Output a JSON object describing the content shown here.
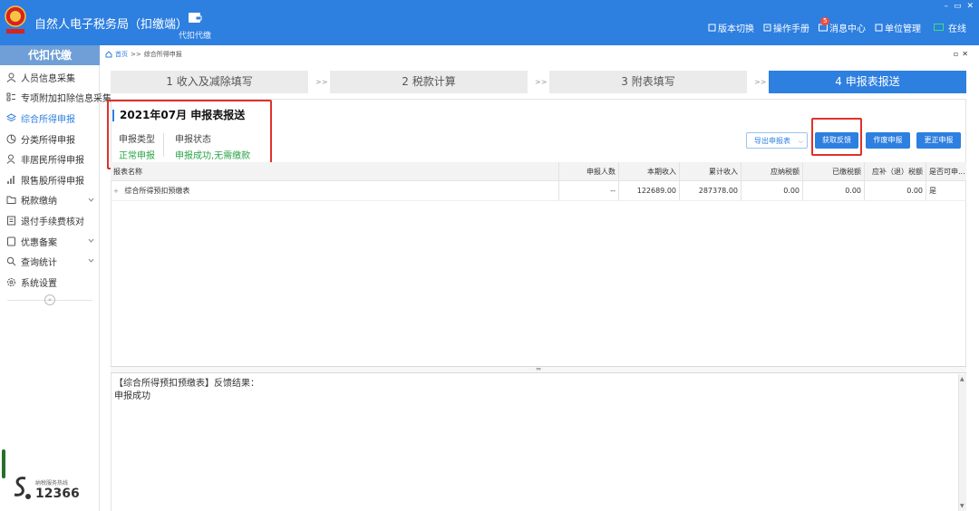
{
  "header": {
    "app_title": "自然人电子税务局（扣缴端）",
    "module_label": "代扣代缴",
    "links": {
      "version_switch": "版本切换",
      "manual": "操作手册",
      "message_center": "消息中心",
      "message_count": "5",
      "unit_management": "单位管理",
      "online_status": "在线"
    },
    "window_controls": [
      "–",
      "▭",
      "✕"
    ]
  },
  "sidebar": {
    "header": "代扣代缴",
    "items": [
      {
        "label": "人员信息采集",
        "icon": "person-icon"
      },
      {
        "label": "专项附加扣除信息采集",
        "icon": "list-icon"
      },
      {
        "label": "综合所得申报",
        "icon": "layers-icon",
        "active": true
      },
      {
        "label": "分类所得申报",
        "icon": "pie-icon"
      },
      {
        "label": "非居民所得申报",
        "icon": "user-icon"
      },
      {
        "label": "限售股所得申报",
        "icon": "bar-chart-icon"
      },
      {
        "label": "税款缴纳",
        "icon": "folder-icon",
        "expandable": true
      },
      {
        "label": "退付手续费核对",
        "icon": "document-icon"
      },
      {
        "label": "优惠备案",
        "icon": "file-icon",
        "expandable": true
      },
      {
        "label": "查询统计",
        "icon": "search-icon",
        "expandable": true
      },
      {
        "label": "系统设置",
        "icon": "gear-icon"
      }
    ],
    "hotline_label": "纳税服务热线",
    "hotline_number": "12366"
  },
  "breadcrumb": {
    "home": "首页",
    "separator": ">>",
    "current": "综合所得申报"
  },
  "steps": [
    {
      "label": "1 收入及减除填写",
      "active": false
    },
    {
      "label": "2 税款计算",
      "active": false
    },
    {
      "label": "3 附表填写",
      "active": false
    },
    {
      "label": "4 申报表报送",
      "active": true
    }
  ],
  "step_separator": ">>",
  "declaration": {
    "period_title": "2021年07月  申报表报送",
    "type_label": "申报类型",
    "type_value": "正常申报",
    "status_label": "申报状态",
    "status_value": "申报成功,无需缴款"
  },
  "actions": {
    "export": "导出申报表",
    "get_feedback": "获取反馈",
    "void_declaration": "作废申报",
    "correct_declaration": "更正申报"
  },
  "table": {
    "columns": [
      "报表名称",
      "申报人数",
      "本期收入",
      "累计收入",
      "应纳税额",
      "已缴税额",
      "应补（退）税额",
      "是否可申..."
    ],
    "rows": [
      {
        "name": "综合所得预扣预缴表",
        "count": "--",
        "current_income": "122689.00",
        "cumulative_income": "287378.00",
        "tax_payable": "0.00",
        "tax_paid": "0.00",
        "tax_due": "0.00",
        "declarable": "是"
      }
    ]
  },
  "result": {
    "line1": "【综合所得预扣预缴表】反馈结果：",
    "line2": "申报成功"
  },
  "colors": {
    "primary": "#2d7fe0",
    "success": "#2aa44a",
    "highlight": "#e0312b",
    "sidebar_header": "#6f9fd6"
  }
}
